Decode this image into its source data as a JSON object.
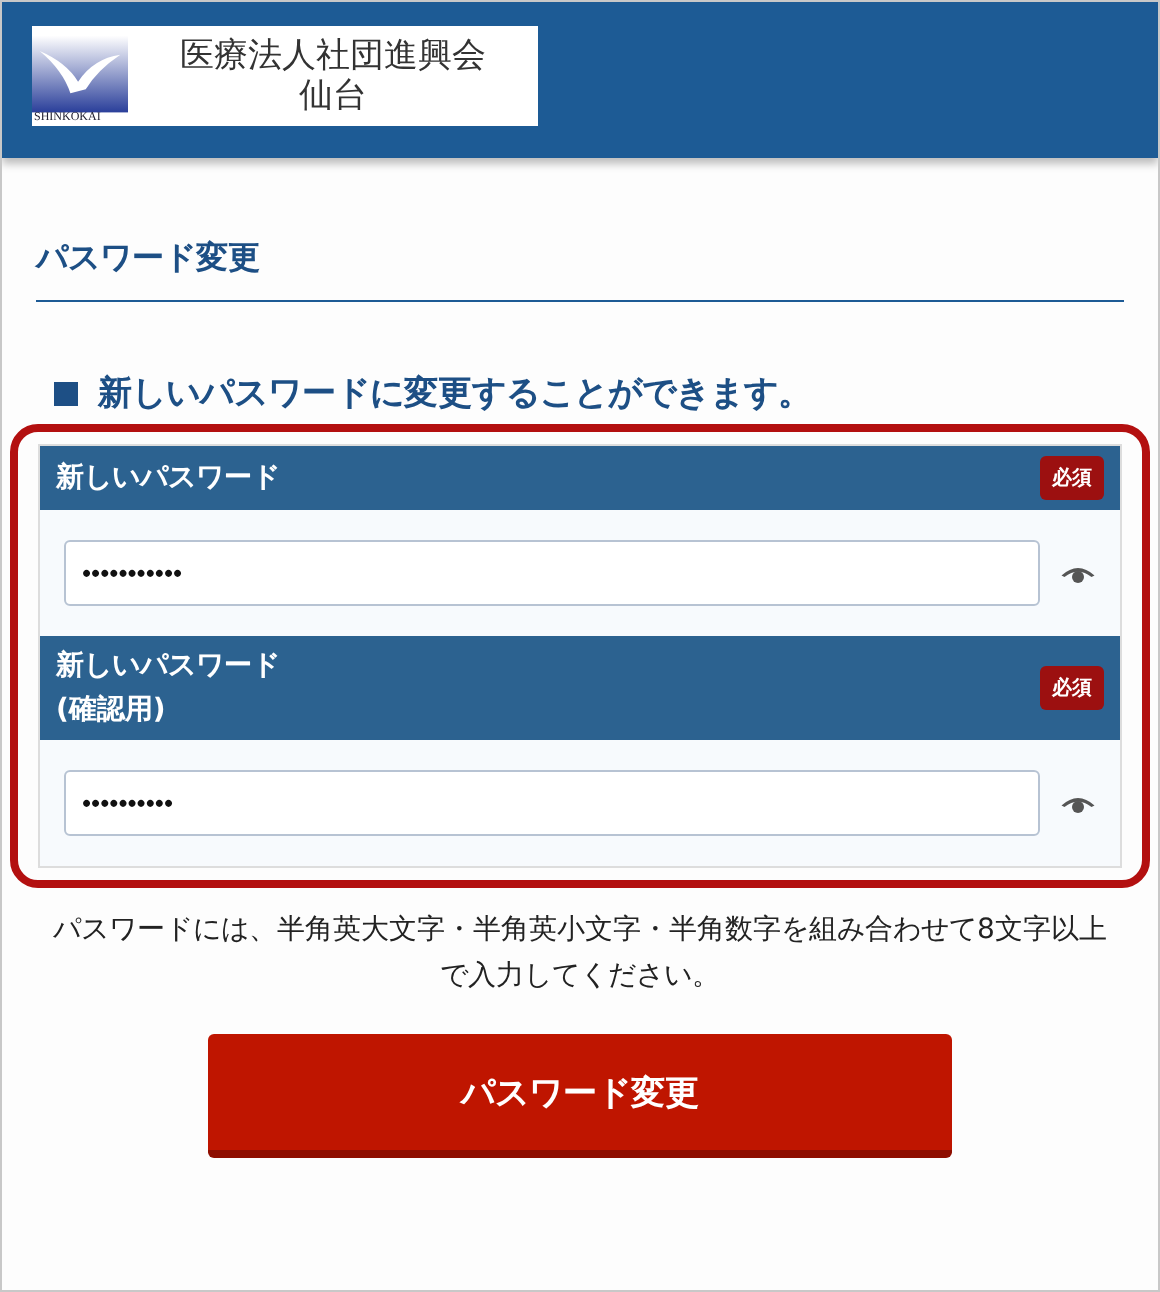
{
  "header": {
    "logo": {
      "org_name": "医療法人社団進興会",
      "branch": "仙台",
      "wordmark": "SHINKOKAI"
    }
  },
  "page_title": "パスワード変更",
  "subheading": "新しいパスワードに変更することができます。",
  "fields": [
    {
      "label_lines": [
        "新しいパスワード"
      ],
      "badge": "必須",
      "value": "•••••••••••"
    },
    {
      "label_lines": [
        "新しいパスワード",
        "(確認用)"
      ],
      "badge": "必須",
      "value": "••••••••••"
    }
  ],
  "note": "パスワードには、半角英大文字・半角英小文字・半角数字を組み合わせて8文字以上で入力してください。",
  "submit_button": "パスワード変更"
}
